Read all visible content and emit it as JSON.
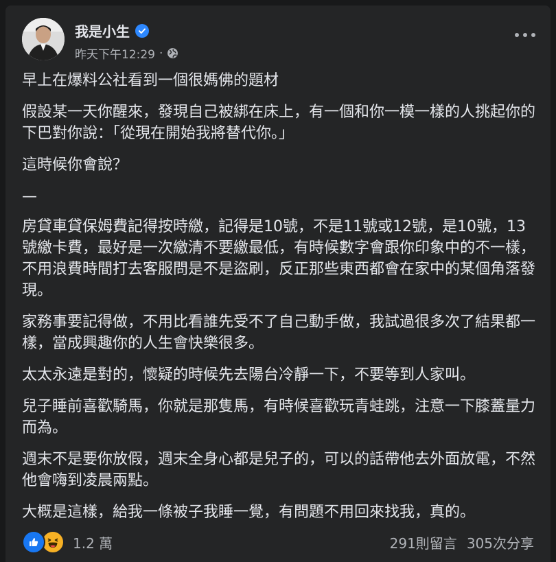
{
  "post": {
    "author": "我是小生",
    "timestamp": "昨天下午12:29",
    "separator": "·",
    "audience_icon": "globe-icon",
    "verified_icon": "verified-badge-icon",
    "more_icon": "more-options-icon",
    "paragraphs": [
      "早上在爆料公社看到一個很媽佛的題材",
      "假設某一天你醒來，發現自己被綁在床上，有一個和你一模一樣的人挑起你的下巴對你說：「從現在開始我將替代你。」",
      "這時候你會說？",
      "—",
      "房貸車貸保姆費記得按時繳，記得是10號，不是11號或12號，是10號，13號繳卡費，最好是一次繳清不要繳最低，有時候數字會跟你印象中的不一樣，不用浪費時間打去客服問是不是盜刷，反正那些東西都會在家中的某個角落發現。",
      "家務事要記得做，不用比看誰先受不了自己動手做，我試過很多次了結果都一樣，當成興趣你的人生會快樂很多。",
      "太太永遠是對的，懷疑的時候先去陽台冷靜一下，不要等到人家叫。",
      "兒子睡前喜歡騎馬，你就是那隻馬，有時候喜歡玩青蛙跳，注意一下膝蓋量力而為。",
      "週末不是要你放假，週末全身心都是兒子的，可以的話帶他去外面放電，不然他會嗨到凌晨兩點。",
      "大概是這樣，給我一條被子我睡一覺，有問題不用回來找我，真的。"
    ]
  },
  "footer": {
    "reactions": [
      "like-icon",
      "haha-icon"
    ],
    "reaction_count": "1.2 萬",
    "comments": "291則留言",
    "shares": "305次分享"
  },
  "colors": {
    "page_bg": "#18191a",
    "card_bg": "#242526",
    "text_primary": "#e4e6eb",
    "text_secondary": "#b0b3b8",
    "verified_blue": "#2d88ff",
    "like_blue": "#1877f2",
    "haha_yellow": "#f7b125"
  }
}
